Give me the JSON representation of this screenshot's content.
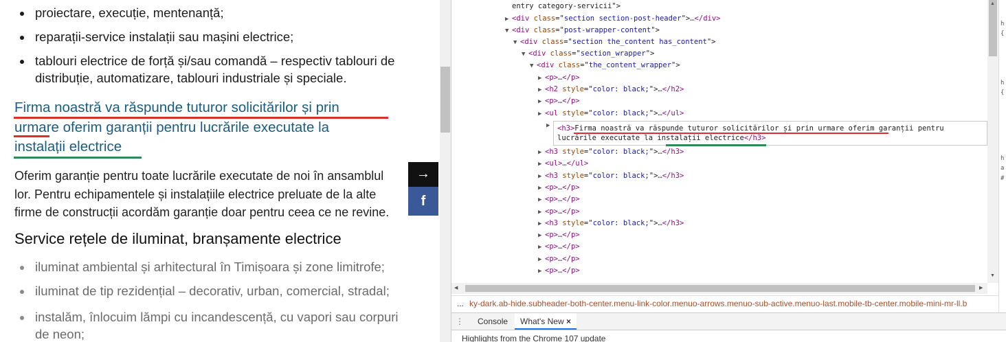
{
  "page": {
    "bullets_top": [
      {
        "lines": [
          "proiectare, execuție, mentenanță;"
        ]
      },
      {
        "lines": [
          "reparații-service instalații sau mașini electrice;"
        ]
      },
      {
        "lines": [
          "tablouri electrice de forță și/sau comandă – respectiv tablouri de",
          "distribuție, automatizare, tablouri industriale și speciale."
        ]
      }
    ],
    "heading3_lines": [
      "Firma noastră va răspunde tuturor solicitărilor și prin",
      "urmare oferim garanții pentru lucrările executate la",
      "instalații electrice"
    ],
    "paragraph_lines": [
      "Oferim garanție pentru toate lucrările executate de noi în ansamblul",
      "lor. Pentru echipamentele și instalațiile electrice preluate de la alte",
      "firme de construcții acordăm garanție doar pentru ceea ce ne revine."
    ],
    "heading2": "Service rețele de iluminat, branșamente electrice",
    "bullets_bottom": [
      {
        "lines": [
          "iluminat ambiental și arhitectural în Timișoara și zone limitrofe;"
        ]
      },
      {
        "lines": [
          "iluminat de tip rezidențial – decorativ, urban, comercial, stradal;"
        ]
      },
      {
        "lines": [
          "instalăm, înlocuim lămpi cu incandescență, cu vapori sau corpuri",
          "de neon;"
        ]
      }
    ],
    "share": {
      "arrow": "→",
      "facebook": "f"
    },
    "colors": {
      "heading": "#1a5d80",
      "red_underline": "#d9302c",
      "green_underline": "#2e8b57",
      "facebook": "#3b5998"
    }
  },
  "devtools": {
    "dom_lines": [
      {
        "indent": 0,
        "tri": "",
        "parts": [
          [
            "t",
            "entry category-servicii\">"
          ]
        ]
      },
      {
        "indent": 0,
        "tri": "▶",
        "parts": [
          [
            "g",
            "<div "
          ],
          [
            "a",
            "class"
          ],
          [
            "t",
            "=\""
          ],
          [
            "v",
            "section section-post-header"
          ],
          [
            "t",
            "\">"
          ],
          [
            "e",
            "…"
          ],
          [
            "g",
            "</div>"
          ]
        ]
      },
      {
        "indent": 0,
        "tri": "▼",
        "parts": [
          [
            "g",
            "<div "
          ],
          [
            "a",
            "class"
          ],
          [
            "t",
            "=\""
          ],
          [
            "v",
            "post-wrapper-content"
          ],
          [
            "t",
            "\">"
          ]
        ]
      },
      {
        "indent": 1,
        "tri": "▼",
        "parts": [
          [
            "g",
            "<div "
          ],
          [
            "a",
            "class"
          ],
          [
            "t",
            "=\""
          ],
          [
            "v",
            "section the_content has_content"
          ],
          [
            "t",
            "\">"
          ]
        ]
      },
      {
        "indent": 2,
        "tri": "▼",
        "parts": [
          [
            "g",
            "<div "
          ],
          [
            "a",
            "class"
          ],
          [
            "t",
            "=\""
          ],
          [
            "v",
            "section_wrapper"
          ],
          [
            "t",
            "\">"
          ]
        ]
      },
      {
        "indent": 3,
        "tri": "▼",
        "parts": [
          [
            "g",
            "<div "
          ],
          [
            "a",
            "class"
          ],
          [
            "t",
            "=\""
          ],
          [
            "v",
            "the_content_wrapper"
          ],
          [
            "t",
            "\">"
          ]
        ]
      },
      {
        "indent": 4,
        "tri": "▶",
        "parts": [
          [
            "g",
            "<p>"
          ],
          [
            "e",
            "…"
          ],
          [
            "g",
            "</p>"
          ]
        ]
      },
      {
        "indent": 4,
        "tri": "▶",
        "parts": [
          [
            "g",
            "<h2 "
          ],
          [
            "a",
            "style"
          ],
          [
            "t",
            "=\""
          ],
          [
            "v",
            "color: black;"
          ],
          [
            "t",
            "\">"
          ],
          [
            "e",
            "…"
          ],
          [
            "g",
            "</h2>"
          ]
        ]
      },
      {
        "indent": 4,
        "tri": "▶",
        "parts": [
          [
            "g",
            "<p>"
          ],
          [
            "e",
            "…"
          ],
          [
            "g",
            "</p>"
          ]
        ]
      },
      {
        "indent": 4,
        "tri": "▶",
        "parts": [
          [
            "g",
            "<ul "
          ],
          [
            "a",
            "style"
          ],
          [
            "t",
            "=\""
          ],
          [
            "v",
            "color: black;"
          ],
          [
            "t",
            "\">"
          ],
          [
            "e",
            "…"
          ],
          [
            "g",
            "</ul>"
          ]
        ]
      },
      {
        "indent": 4,
        "tri": "▶",
        "parts": [
          [
            "g",
            "<p>"
          ],
          [
            "e",
            "…"
          ],
          [
            "g",
            "</p>"
          ]
        ]
      },
      {
        "indent": 4,
        "tri": "▶",
        "parts": [
          [
            "g",
            "<h3 "
          ],
          [
            "a",
            "style"
          ],
          [
            "t",
            "=\""
          ],
          [
            "v",
            "color: black;"
          ],
          [
            "t",
            "\">"
          ],
          [
            "e",
            "…"
          ],
          [
            "g",
            "</h3>"
          ]
        ]
      },
      {
        "indent": 4,
        "tri": "▶",
        "parts": [
          [
            "g",
            "<ul>"
          ],
          [
            "e",
            "…"
          ],
          [
            "g",
            "</ul>"
          ]
        ]
      },
      {
        "indent": 4,
        "tri": "▶",
        "parts": [
          [
            "g",
            "<h3 "
          ],
          [
            "a",
            "style"
          ],
          [
            "t",
            "=\""
          ],
          [
            "v",
            "color: black;"
          ],
          [
            "t",
            "\">"
          ],
          [
            "e",
            "…"
          ],
          [
            "g",
            "</h3>"
          ]
        ]
      },
      {
        "indent": 4,
        "tri": "▶",
        "parts": [
          [
            "g",
            "<p>"
          ],
          [
            "e",
            "…"
          ],
          [
            "g",
            "</p>"
          ]
        ]
      },
      {
        "indent": 4,
        "tri": "▶",
        "parts": [
          [
            "g",
            "<p>"
          ],
          [
            "e",
            "…"
          ],
          [
            "g",
            "</p>"
          ]
        ]
      },
      {
        "indent": 4,
        "tri": "▶",
        "parts": [
          [
            "g",
            "<p>"
          ],
          [
            "e",
            "…"
          ],
          [
            "g",
            "</p>"
          ]
        ]
      },
      {
        "indent": 4,
        "tri": "▶",
        "parts": [
          [
            "g",
            "<h3 "
          ],
          [
            "a",
            "style"
          ],
          [
            "t",
            "=\""
          ],
          [
            "v",
            "color: black;"
          ],
          [
            "t",
            "\">"
          ],
          [
            "e",
            "…"
          ],
          [
            "g",
            "</h3>"
          ]
        ]
      },
      {
        "indent": 4,
        "tri": "▶",
        "parts": [
          [
            "g",
            "<p>"
          ],
          [
            "e",
            "…"
          ],
          [
            "g",
            "</p>"
          ]
        ]
      },
      {
        "indent": 4,
        "tri": "▶",
        "parts": [
          [
            "g",
            "<p>"
          ],
          [
            "e",
            "…"
          ],
          [
            "g",
            "</p>"
          ]
        ]
      },
      {
        "indent": 4,
        "tri": "▶",
        "parts": [
          [
            "g",
            "<p>"
          ],
          [
            "e",
            "…"
          ],
          [
            "g",
            "</p>"
          ]
        ]
      },
      {
        "indent": 4,
        "tri": "▶",
        "parts": [
          [
            "g",
            "<p>"
          ],
          [
            "e",
            "…"
          ],
          [
            "g",
            "</p>"
          ]
        ]
      }
    ],
    "selected_element": {
      "line1_tag": "<h3>",
      "line1_text": "Firma noastră va răspunde tuturor solicitărilor și prin urmare oferim garanții pentru",
      "line2_text": "lucrările executate la instalații electrice",
      "line2_close": "</h3>"
    },
    "breadcrumb_prefix": "...",
    "breadcrumb": "ky-dark.ab-hide.subheader-both-center.menu-link-color.menuo-arrows.menuo-sub-active.menuo-last.mobile-tb-center.mobile-mini-mr-ll.b",
    "drawer_tabs": [
      {
        "label": "Console"
      },
      {
        "label": "What's New"
      }
    ],
    "drawer_close": "×",
    "drawer_text": "Highlights from the Chrome 107 update",
    "styles_fragments": [
      "h",
      "{",
      "h",
      "{",
      "h",
      "a",
      "#"
    ]
  }
}
